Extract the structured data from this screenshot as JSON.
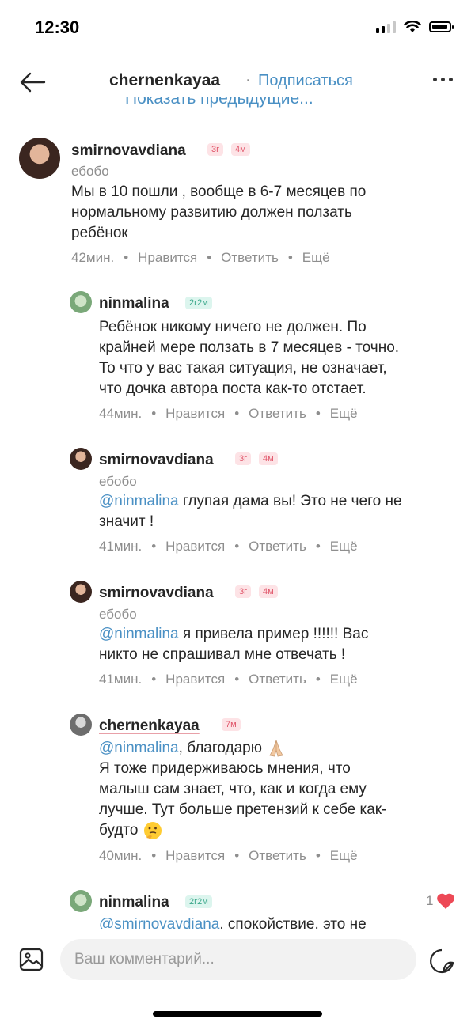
{
  "status": {
    "time": "12:30"
  },
  "header": {
    "title": "chernenkayaa",
    "dot": "·",
    "subscribe_label": "Подписаться",
    "show_previous": "Показать предыдущие..."
  },
  "colors": {
    "link": "#4a90c4",
    "badge_pink_bg": "#fde3e6",
    "badge_green_bg": "#dcf5ee",
    "heart": "#ed4956"
  },
  "comments": [
    {
      "username": "smirnovavdiana",
      "badges": [
        "3г",
        "4м"
      ],
      "subtitle": "ебобо",
      "lines": [
        "Мы в 10 пошли , вообще в 6-7 месяцев по",
        "нормальному развитию должен ползать",
        "ребёнок"
      ],
      "time": "42мин.",
      "like": "Нравится",
      "reply": "Ответить",
      "more": "Ещё"
    },
    {
      "username": "ninmalina",
      "badges": [
        "2г2м"
      ],
      "lines": [
        "Ребёнок никому ничего не должен. По",
        "крайней мере ползать в 7 месяцев - точно.",
        "То что у вас такая ситуация, не означает,",
        "что дочка автора поста как-то отстает."
      ],
      "time": "44мин.",
      "like": "Нравится",
      "reply": "Ответить",
      "more": "Ещё"
    },
    {
      "username": "smirnovavdiana",
      "badges": [
        "3г",
        "4м"
      ],
      "subtitle": "ебобо",
      "mention": "@ninmalina",
      "lines": [
        " глупая дама вы! Это не чего не",
        "значит !"
      ],
      "time": "41мин.",
      "like": "Нравится",
      "reply": "Ответить",
      "more": "Ещё"
    },
    {
      "username": "smirnovavdiana",
      "badges": [
        "3г",
        "4м"
      ],
      "subtitle": "ебобо",
      "mention": "@ninmalina",
      "lines": [
        " я привела пример !!!!!! Вас",
        "никто не спрашивал мне отвечать !"
      ],
      "time": "41мин.",
      "like": "Нравится",
      "reply": "Ответить",
      "more": "Ещё"
    },
    {
      "username": "chernenkayaa",
      "badges": [
        "7м"
      ],
      "mention": "@ninmalina",
      "lines": [
        ", благодарю",
        "Я тоже придерживаюсь мнения, что",
        "малыш сам знает, что, как и когда ему",
        "лучше. Тут больше претензий к себе как-",
        "будто"
      ],
      "time": "40мин.",
      "like": "Нравится",
      "reply": "Ответить",
      "more": "Ещё"
    },
    {
      "username": "ninmalina",
      "badges": [
        "2г2м"
      ],
      "mention": "@smirnovavdiana",
      "lines": [
        ", спокойствие, это не"
      ],
      "likes_count": "1"
    }
  ],
  "input": {
    "placeholder": "Ваш комментарий..."
  }
}
